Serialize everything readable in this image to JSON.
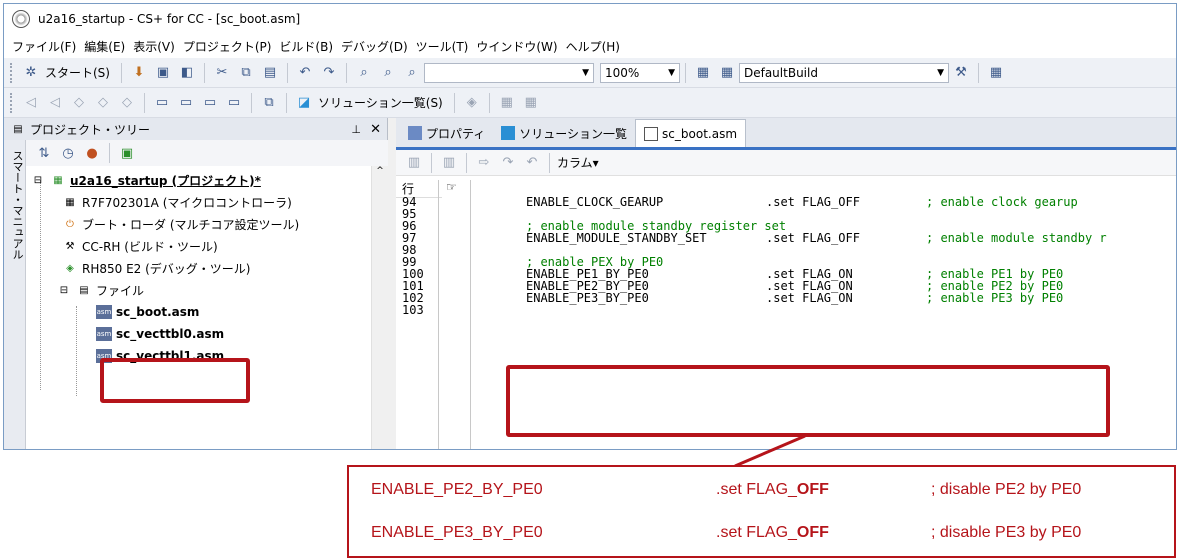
{
  "window": {
    "title": "u2a16_startup - CS+ for CC - [sc_boot.asm]"
  },
  "menu": [
    "ファイル(F)",
    "編集(E)",
    "表示(V)",
    "プロジェクト(P)",
    "ビルド(B)",
    "デバッグ(D)",
    "ツール(T)",
    "ウインドウ(W)",
    "ヘルプ(H)"
  ],
  "toolbar1": {
    "start_label": "スタート(S)",
    "zoom": "100%",
    "build_config": "DefaultBuild"
  },
  "toolbar2": {
    "solution_list_label": "ソリューション一覧(S)"
  },
  "tree": {
    "header": "プロジェクト・ツリー",
    "sidetab": "スマート・マニュアル",
    "project": "u2a16_startup (プロジェクト)*",
    "nodes": [
      "R7F702301A (マイクロコントローラ)",
      "ブート・ローダ (マルチコア設定ツール)",
      "CC-RH (ビルド・ツール)",
      "RH850 E2 (デバッグ・ツール)",
      "ファイル",
      "sc_boot.asm",
      "sc_vecttbl0.asm",
      "sc_vecttbl1.asm"
    ]
  },
  "editor": {
    "tabs": [
      "プロパティ",
      "ソリューション一覧",
      "sc_boot.asm"
    ],
    "column_label": "カラム",
    "gutter_header": "行",
    "lines": [
      {
        "num": "94",
        "code": "ENABLE_CLOCK_GEARUP",
        "set": ".set FLAG_OFF",
        "comment": "; enable clock gearup"
      },
      {
        "num": "95",
        "code": "",
        "set": "",
        "comment": ""
      },
      {
        "num": "96",
        "code": "; enable module standby register set",
        "set": "",
        "comment": ""
      },
      {
        "num": "97",
        "code": "ENABLE_MODULE_STANDBY_SET",
        "set": ".set FLAG_OFF",
        "comment": "; enable module standby r"
      },
      {
        "num": "98",
        "code": "",
        "set": "",
        "comment": ""
      },
      {
        "num": "99",
        "code": "; enable PEX by PE0",
        "set": "",
        "comment": ""
      },
      {
        "num": "100",
        "code": "ENABLE_PE1_BY_PE0",
        "set": ".set FLAG_ON",
        "comment": "; enable PE1 by PE0"
      },
      {
        "num": "101",
        "code": "ENABLE_PE2_BY_PE0",
        "set": ".set FLAG_ON",
        "comment": "; enable PE2 by PE0"
      },
      {
        "num": "102",
        "code": "ENABLE_PE3_BY_PE0",
        "set": ".set FLAG_ON",
        "comment": "; enable PE3 by PE0"
      },
      {
        "num": "103",
        "code": "",
        "set": "",
        "comment": ""
      }
    ]
  },
  "callout": {
    "lines": [
      {
        "name": "ENABLE_PE2_BY_PE0",
        "set_prefix": ".set FLAG_",
        "set_value": "OFF",
        "comment": "; disable PE2 by PE0"
      },
      {
        "name": "ENABLE_PE3_BY_PE0",
        "set_prefix": ".set FLAG_",
        "set_value": "OFF",
        "comment": "; disable PE3 by PE0"
      }
    ]
  },
  "colors": {
    "highlight": "#b5141a",
    "accent": "#3a72c4"
  }
}
